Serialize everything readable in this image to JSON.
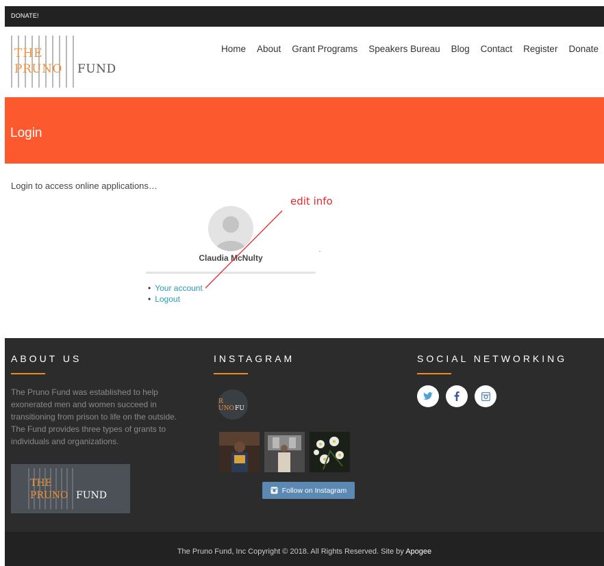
{
  "topbar": {
    "donate_label": "DONATE!"
  },
  "logo": {
    "line1": "THE",
    "line2": "PRUNO",
    "line3": "FUND"
  },
  "nav": {
    "items": [
      "Home",
      "About",
      "Grant Programs",
      "Speakers Bureau",
      "Blog",
      "Contact",
      "Register",
      "Donate"
    ]
  },
  "banner": {
    "title": "Login"
  },
  "main": {
    "intro": "Login to access online applications…",
    "user_name": "Claudia McNulty",
    "links": [
      "Your account",
      "Logout"
    ]
  },
  "annotation": {
    "text": "edit info",
    "color": "#e8262a"
  },
  "footer": {
    "about": {
      "heading": "ABOUT US",
      "text": "The Pruno Fund was established to help exonerated men and women succeed in transitioning from prison to life on the outside. The Fund provides three types of grants to individuals and organizations."
    },
    "instagram": {
      "heading": "INSTAGRAM",
      "follow_label": "Follow on Instagram"
    },
    "social": {
      "heading": "SOCIAL NETWORKING",
      "icons": [
        "twitter-icon",
        "facebook-icon",
        "instagram-icon"
      ]
    },
    "accent_color": "#f08c1e"
  },
  "copyright": {
    "text": "The Pruno Fund, Inc   Copyright © 2018. All Rights Reserved.   Site by ",
    "site_by": "Apogee"
  },
  "colors": {
    "banner": "#fc5a2e",
    "footer": "#2c2c2c",
    "link": "#2a9bb3",
    "logo_orange": "#f0913a"
  }
}
